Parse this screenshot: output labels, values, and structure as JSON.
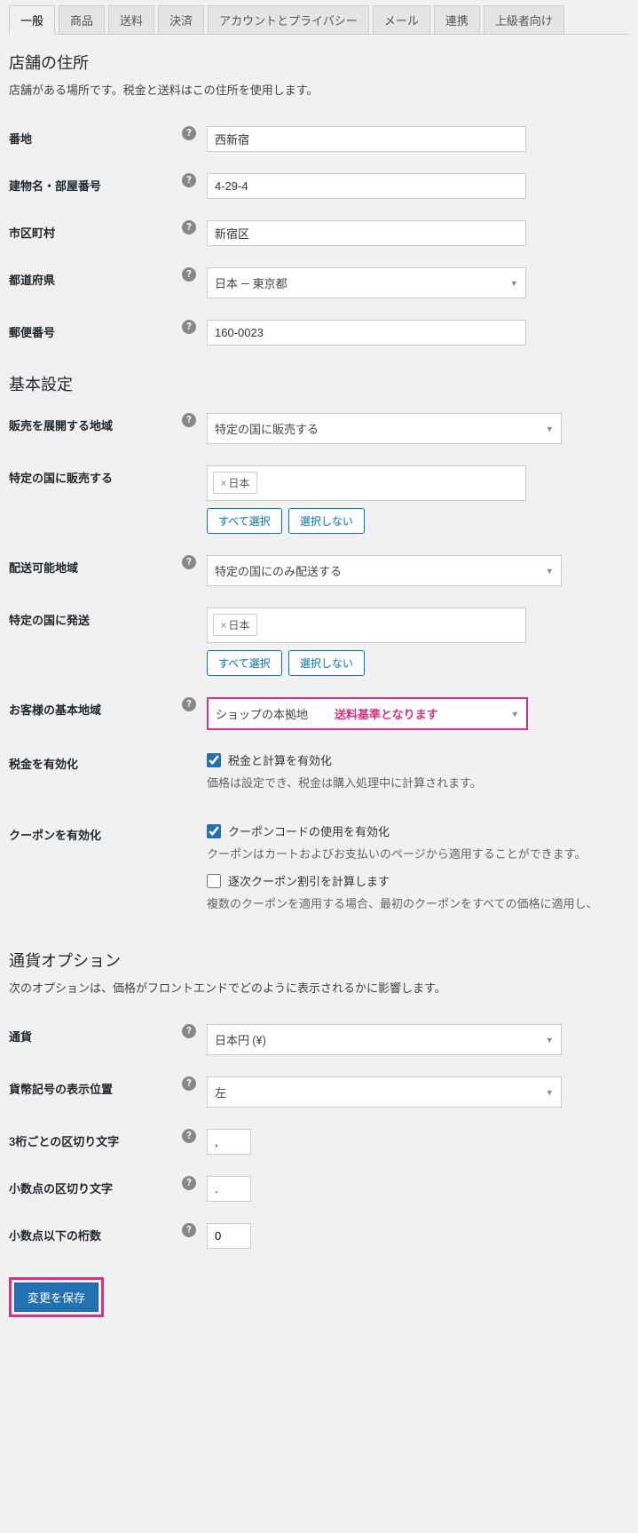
{
  "tabs": [
    "一般",
    "商品",
    "送料",
    "決済",
    "アカウントとプライバシー",
    "メール",
    "連携",
    "上級者向け"
  ],
  "activeTab": 0,
  "sections": {
    "address": {
      "title": "店舗の住所",
      "desc": "店舗がある場所です。税金と送料はこの住所を使用します。",
      "fields": {
        "line1_label": "番地",
        "line1": "西新宿",
        "line2_label": "建物名・部屋番号",
        "line2": "4-29-4",
        "city_label": "市区町村",
        "city": "新宿区",
        "state_label": "都道府県",
        "state": "日本 — 東京都",
        "postcode_label": "郵便番号",
        "postcode": "160-0023"
      }
    },
    "general": {
      "title": "基本設定",
      "selling_label": "販売を展開する地域",
      "selling": "特定の国に販売する",
      "sell_countries_label": "特定の国に販売する",
      "sell_tag": "日本",
      "select_all": "すべて選択",
      "select_none": "選択しない",
      "shipping_label": "配送可能地域",
      "shipping": "特定の国にのみ配送する",
      "ship_countries_label": "特定の国に発送",
      "ship_tag": "日本",
      "default_loc_label": "お客様の基本地域",
      "default_loc": "ショップの本拠地",
      "annotation": "送料基準となります",
      "tax_label": "税金を有効化",
      "tax_check": "税金と計算を有効化",
      "tax_help": "価格は設定でき、税金は購入処理中に計算されます。",
      "coupon_label": "クーポンを有効化",
      "coupon_check": "クーポンコードの使用を有効化",
      "coupon_help": "クーポンはカートおよびお支払いのページから適用することができます。",
      "seq_check": "逐次クーポン割引を計算します",
      "seq_help": "複数のクーポンを適用する場合、最初のクーポンをすべての価格に適用し、"
    },
    "currency": {
      "title": "通貨オプション",
      "desc": "次のオプションは、価格がフロントエンドでどのように表示されるかに影響します。",
      "currency_label": "通貨",
      "currency": "日本円 (¥)",
      "pos_label": "貨幣記号の表示位置",
      "pos": "左",
      "thou_label": "3桁ごとの区切り文字",
      "thou": ",",
      "dec_label": "小数点の区切り文字",
      "dec": ".",
      "num_label": "小数点以下の桁数",
      "num": "0"
    }
  },
  "save": "変更を保存"
}
